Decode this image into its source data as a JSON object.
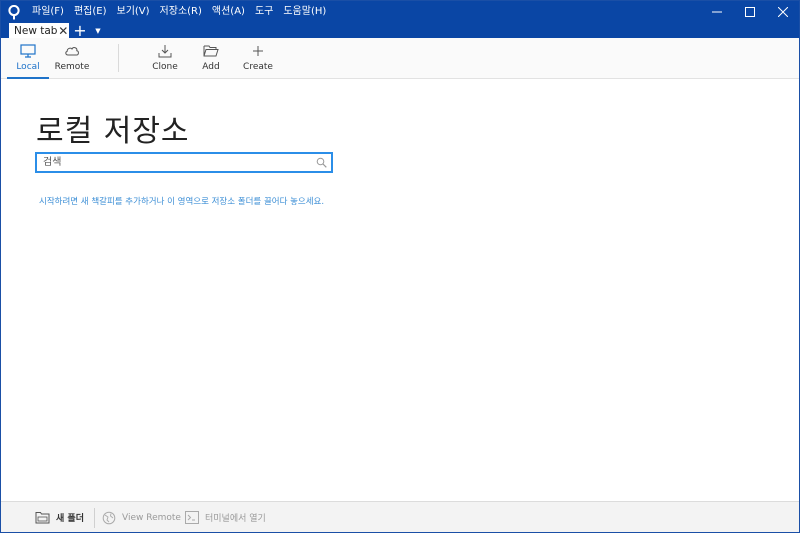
{
  "menu": {
    "items": [
      "파일(F)",
      "편집(E)",
      "보기(V)",
      "저장소(R)",
      "액션(A)",
      "도구",
      "도움말(H)"
    ]
  },
  "window_controls": {
    "minimize": "—",
    "maximize": "☐",
    "close": "✕"
  },
  "tabs": {
    "active_label": "New tab",
    "close_glyph": "✕",
    "add_glyph": "+",
    "dropdown_glyph": "▼"
  },
  "toolbar": {
    "local": "Local",
    "remote": "Remote",
    "clone": "Clone",
    "add": "Add",
    "create": "Create",
    "accent_color": "#1f73c9"
  },
  "main": {
    "title": "로컬 저장소",
    "search_placeholder": "검색",
    "hint": "시작하려면 새 책갈피를 추가하거나 이 영역으로 저장소 폴더를 끌어다 놓으세요."
  },
  "footer": {
    "new_folder": "새 폴더",
    "view_remote": "View Remote",
    "open_terminal": "터미널에서 열기"
  },
  "colors": {
    "titlebar": "#0a46a5",
    "link": "#3d8fd6",
    "focus": "#2b8ee8"
  }
}
